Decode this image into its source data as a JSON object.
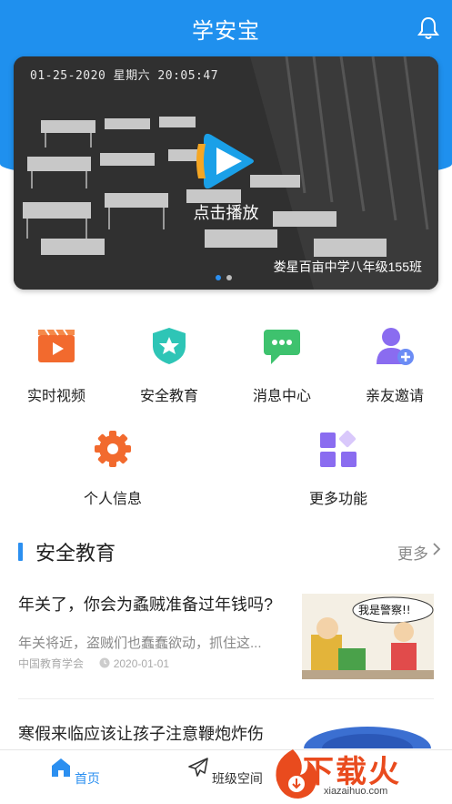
{
  "header": {
    "title": "学安宝"
  },
  "banner": {
    "cam_timestamp": "01-25-2020 星期六 20:05:47",
    "play_label": "点击播放",
    "camera_name": "娄星百亩中学八年级155班",
    "page_count": 2,
    "active_page": 1
  },
  "features": [
    {
      "label": "实时视频",
      "icon": "video-icon"
    },
    {
      "label": "安全教育",
      "icon": "shield-star-icon"
    },
    {
      "label": "消息中心",
      "icon": "message-icon"
    },
    {
      "label": "亲友邀请",
      "icon": "add-user-icon"
    },
    {
      "label": "个人信息",
      "icon": "gear-icon"
    },
    {
      "label": "更多功能",
      "icon": "grid-icon"
    }
  ],
  "section": {
    "title": "安全教育",
    "more_label": "更多"
  },
  "articles": [
    {
      "title": "年关了，你会为蟊贼准备过年钱吗?",
      "summary": "年关将近，盗贼们也蠢蠢欲动，抓住这...",
      "source": "中国教育学会",
      "date": "2020-01-01",
      "thumb_caption": "我是警察!!"
    },
    {
      "title": "寒假来临应该让孩子注意鞭炮炸伤"
    }
  ],
  "tabbar": [
    {
      "label": "首页",
      "icon": "home-icon",
      "active": true
    },
    {
      "label": "班级空间",
      "icon": "paper-plane-icon",
      "active": false
    }
  ],
  "watermark": {
    "text": "下载火",
    "url": "xiazaihuo.com"
  },
  "colors": {
    "primary": "#1f90ee",
    "accent_orange": "#f26a2e",
    "teal": "#2ec5b6",
    "green": "#3ec26e",
    "purple": "#8a6cf0"
  }
}
